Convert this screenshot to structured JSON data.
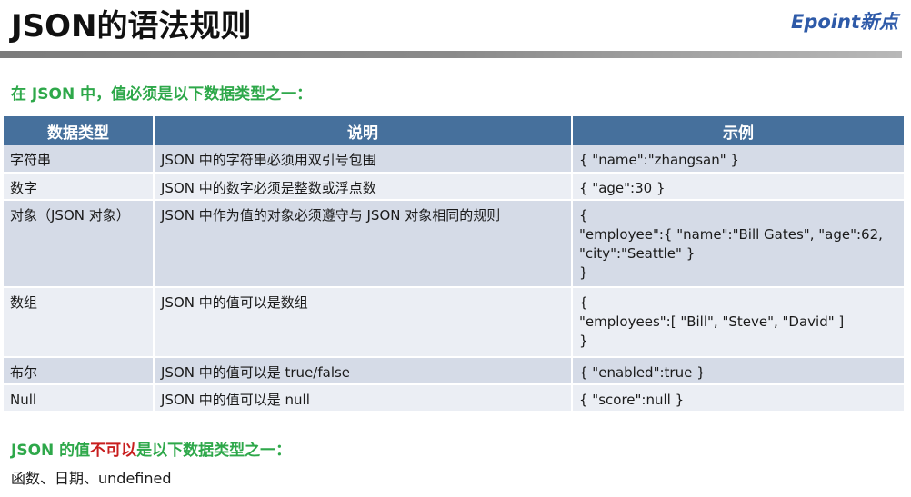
{
  "header": {
    "title": "JSON的语法规则",
    "logo_text": "Epoint新点"
  },
  "heading_valid": "在 JSON 中，值必须是以下数据类型之一：",
  "table": {
    "columns": [
      "数据类型",
      "说明",
      "示例"
    ],
    "rows": [
      {
        "type": "字符串",
        "desc": "JSON 中的字符串必须用双引号包围",
        "example": [
          "{ \"name\":\"zhangsan\" }"
        ]
      },
      {
        "type": "数字",
        "desc": "JSON 中的数字必须是整数或浮点数",
        "example": [
          "{ \"age\":30 }"
        ]
      },
      {
        "type": "对象（JSON 对象）",
        "desc": "JSON 中作为值的对象必须遵守与 JSON 对象相同的规则",
        "example": [
          "{",
          "\"employee\":{ \"name\":\"Bill Gates\", \"age\":62, \"city\":\"Seattle\" }",
          "}"
        ]
      },
      {
        "type": "数组",
        "desc": "JSON 中的值可以是数组",
        "example": [
          "{",
          "\"employees\":[ \"Bill\", \"Steve\", \"David\" ]",
          "}"
        ]
      },
      {
        "type": "布尔",
        "desc": "JSON 中的值可以是 true/false",
        "example": [
          "{ \"enabled\":true }"
        ]
      },
      {
        "type": "Null",
        "desc": "JSON 中的值可以是 null",
        "example": [
          "{ \"score\":null }"
        ]
      }
    ]
  },
  "heading_invalid": {
    "prefix": "JSON 的值",
    "emphasis": "不可以",
    "suffix": "是以下数据类型之一："
  },
  "invalid_types": "函数、日期、undefined",
  "colors": {
    "heading_green": "#2ea84a",
    "emphasis_red": "#c81e1e",
    "table_header": "#46709c",
    "row_odd": "#d5dbe7",
    "row_even": "#ebeef4",
    "logo_blue": "#2e5aa8"
  }
}
